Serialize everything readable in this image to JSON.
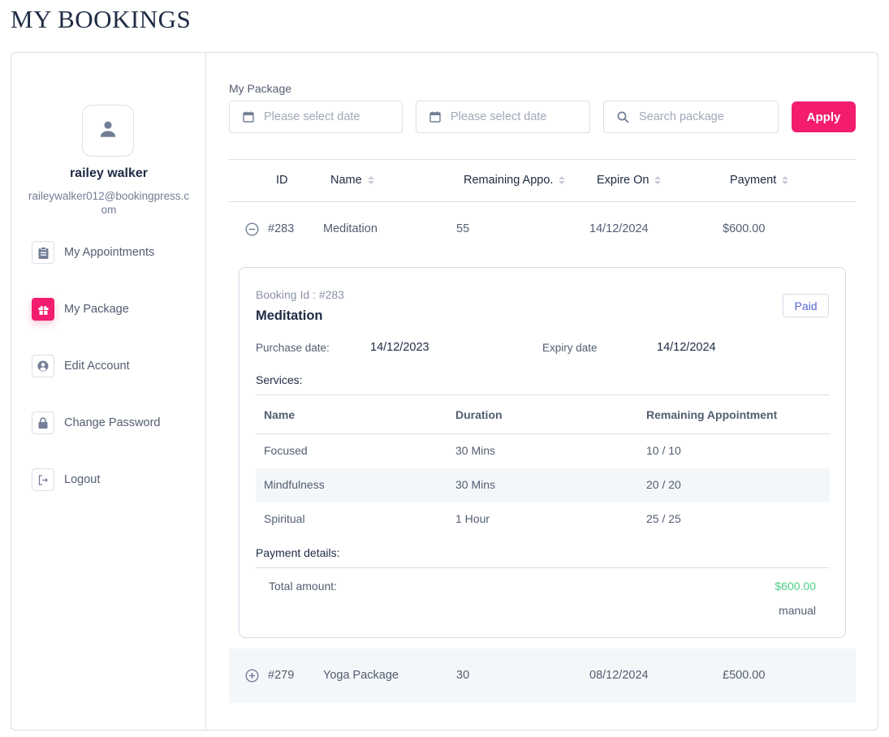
{
  "page": {
    "title": "MY BOOKINGS"
  },
  "colors": {
    "accent": "#f31c6e",
    "paid_badge": "#5466d4",
    "amount_green": "#4fcf87",
    "text_dark": "#202c45",
    "text_muted": "#535d71"
  },
  "sidebar": {
    "avatar_icon": "user-icon",
    "user_name": "railey walker",
    "user_email": "raileywalker012@bookingpress.com",
    "items": [
      {
        "label": "My Appointments",
        "icon": "clipboard-icon",
        "active": false
      },
      {
        "label": "My Package",
        "icon": "gift-icon",
        "active": true
      },
      {
        "label": "Edit Account",
        "icon": "user-circle-icon",
        "active": false
      },
      {
        "label": "Change Password",
        "icon": "lock-icon",
        "active": false
      },
      {
        "label": "Logout",
        "icon": "logout-icon",
        "active": false
      }
    ]
  },
  "filters": {
    "section_label": "My Package",
    "start_date_placeholder": "Please select date",
    "end_date_placeholder": "Please select date",
    "search_placeholder": "Search package",
    "apply_label": "Apply"
  },
  "table": {
    "columns": [
      "ID",
      "Name",
      "Remaining Appo.",
      "Expire On",
      "Payment"
    ],
    "rows": [
      {
        "expanded": true,
        "id": "#283",
        "name": "Meditation",
        "remaining": "55",
        "expire_on": "14/12/2024",
        "payment": "$600.00"
      },
      {
        "expanded": false,
        "id": "#279",
        "name": "Yoga Package",
        "remaining": "30",
        "expire_on": "08/12/2024",
        "payment": "£500.00"
      }
    ]
  },
  "detail": {
    "booking_id_label": "Booking Id : #283",
    "title": "Meditation",
    "status": "Paid",
    "purchase_date_label": "Purchase date:",
    "purchase_date": "14/12/2023",
    "expiry_date_label": "Expiry date",
    "expiry_date": "14/12/2024",
    "services_label": "Services:",
    "services_columns": [
      "Name",
      "Duration",
      "Remaining Appointment"
    ],
    "services": [
      {
        "name": "Focused",
        "duration": "30 Mins",
        "remaining": "10 / 10"
      },
      {
        "name": "Mindfulness",
        "duration": "30 Mins",
        "remaining": "20 / 20"
      },
      {
        "name": "Spiritual",
        "duration": "1 Hour",
        "remaining": "25 / 25"
      }
    ],
    "payment_details_label": "Payment details:",
    "total_amount_label": "Total amount:",
    "total_amount": "$600.00",
    "payment_method": "manual"
  }
}
